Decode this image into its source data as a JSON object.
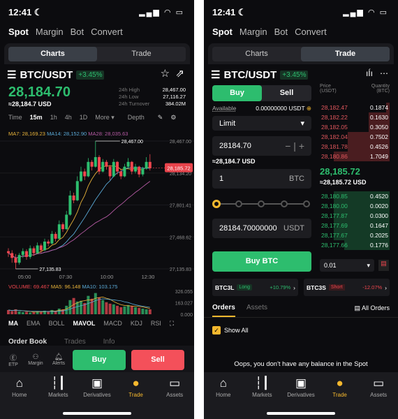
{
  "status": {
    "time": "12:41",
    "moon_icon": "moon-icon",
    "signal": "signal-icon",
    "wifi": "wifi-icon",
    "battery": "battery-icon"
  },
  "top_tabs": [
    "Spot",
    "Margin",
    "Bot",
    "Convert"
  ],
  "segment": {
    "charts": "Charts",
    "trade": "Trade"
  },
  "pair": {
    "name": "BTC/USDT",
    "change": "+3.45%"
  },
  "chart_screen": {
    "price": "28,184.70",
    "usd": "≈28,184.7 USD",
    "stats": [
      {
        "label": "24h High",
        "value": "28,467.00"
      },
      {
        "label": "24h Low",
        "value": "27,116.27"
      },
      {
        "label": "24h Turnover",
        "value": "384.02M"
      }
    ],
    "timeframes": [
      "Time",
      "15m",
      "1h",
      "4h",
      "1D",
      "More ▾",
      "Depth"
    ],
    "ma_legend": {
      "ma7": "MA7: 28,169.23",
      "ma14": "MA14: 28,152.90",
      "ma28": "MA28: 28,035.63"
    },
    "y_ticks": [
      "28,467.00",
      "28,134.20",
      "27,801.41",
      "27,468.62",
      "27,135.83"
    ],
    "x_ticks": [
      "05:00",
      "07:30",
      "10:00",
      "12:30"
    ],
    "high_marker": "28,467.00",
    "low_marker": "27,135.83",
    "last_price": "28,185.72",
    "vol_legend": {
      "vol": "VOLUME: 69.467",
      "ma5": "MA5: 96.148",
      "ma10": "MA10: 103.175"
    },
    "vol_ticks": [
      "326.055",
      "163.027",
      "0.000"
    ],
    "indicators": [
      "MA",
      "EMA",
      "BOLL",
      "MAVOL",
      "MACD",
      "KDJ",
      "RSI"
    ],
    "subtabs": [
      "Order Book",
      "Trades",
      "Info"
    ],
    "actions": [
      {
        "label": "ETP",
        "icon": "etp-icon"
      },
      {
        "label": "Margin",
        "icon": "margin-icon"
      },
      {
        "label": "Alerts",
        "icon": "bell-icon"
      }
    ],
    "buy": "Buy",
    "sell": "Sell"
  },
  "chart_data": {
    "type": "candlestick",
    "ylim": [
      27135.83,
      28467.0
    ],
    "candles": [
      [
        27320,
        27350,
        27260,
        27300
      ],
      [
        27300,
        27330,
        27200,
        27250
      ],
      [
        27250,
        27290,
        27135.83,
        27200
      ],
      [
        27200,
        27300,
        27180,
        27280
      ],
      [
        27280,
        27350,
        27250,
        27320
      ],
      [
        27320,
        27340,
        27230,
        27260
      ],
      [
        27260,
        27380,
        27240,
        27350
      ],
      [
        27350,
        27370,
        27270,
        27300
      ],
      [
        27300,
        27410,
        27290,
        27380
      ],
      [
        27380,
        27400,
        27300,
        27330
      ],
      [
        27330,
        27450,
        27320,
        27420
      ],
      [
        27420,
        27440,
        27370,
        27400
      ],
      [
        27400,
        27530,
        27390,
        27500
      ],
      [
        27500,
        27520,
        27420,
        27450
      ],
      [
        27450,
        27640,
        27440,
        27600
      ],
      [
        27600,
        27620,
        27520,
        27550
      ],
      [
        27550,
        27740,
        27540,
        27700
      ],
      [
        27700,
        27950,
        27690,
        27900
      ],
      [
        27900,
        27930,
        27820,
        27850
      ],
      [
        27850,
        28100,
        27840,
        28050
      ],
      [
        28050,
        28200,
        28040,
        28150
      ],
      [
        28150,
        28180,
        28060,
        28100
      ],
      [
        28100,
        28290,
        28090,
        28250
      ],
      [
        28250,
        28270,
        28160,
        28200
      ],
      [
        28200,
        28467,
        28190,
        28300
      ],
      [
        28300,
        28320,
        28120,
        28150
      ],
      [
        28150,
        28280,
        28140,
        28250
      ],
      [
        28250,
        28270,
        28170,
        28200
      ],
      [
        28200,
        28220,
        28060,
        28100
      ],
      [
        28100,
        28280,
        28090,
        28250
      ],
      [
        28250,
        28260,
        28120,
        28150
      ],
      [
        28150,
        28170,
        28070,
        28100
      ],
      [
        28100,
        28230,
        28090,
        28200
      ],
      [
        28200,
        28290,
        28180,
        28250
      ],
      [
        28250,
        28260,
        28120,
        28150
      ],
      [
        28150,
        28230,
        28130,
        28200
      ],
      [
        28200,
        28210,
        28090,
        28120
      ],
      [
        28120,
        28200,
        28100,
        28180
      ],
      [
        28180,
        28300,
        28170,
        28250
      ],
      [
        28250,
        28330,
        28160,
        28185.72
      ]
    ],
    "volume": [
      60,
      45,
      70,
      40,
      30,
      35,
      25,
      30,
      40,
      35,
      50,
      45,
      60,
      40,
      80,
      70,
      120,
      200,
      230,
      180,
      190,
      160,
      260,
      220,
      300,
      240,
      200,
      170,
      150,
      140,
      120,
      100,
      110,
      130,
      120,
      100,
      90,
      80,
      70,
      69.467
    ]
  },
  "trade_screen": {
    "side_buy": "Buy",
    "side_sell": "Sell",
    "available_label": "Available",
    "available_value": "0.00000000 USDT",
    "order_type": "Limit",
    "price_value": "28184.70",
    "price_usd": "≈28,184.7 USD",
    "amount_value": "1",
    "amount_unit": "BTC",
    "slider_percent": 0,
    "total_value": "28184.70000000",
    "total_unit": "USDT",
    "submit": "Buy BTC",
    "ob_headers": {
      "price": "Price\n(USDT)",
      "qty": "Quantity\n(BTC)"
    },
    "asks": [
      {
        "p": "28,182.47",
        "q": "0.1874",
        "d": 0.95
      },
      {
        "p": "28,182.22",
        "q": "0.1630",
        "d": 0.7
      },
      {
        "p": "28,182.05",
        "q": "0.3050",
        "d": 0.7
      },
      {
        "p": "28,182.04",
        "q": "0.7502",
        "d": 0.4
      },
      {
        "p": "28,181.78",
        "q": "0.4526",
        "d": 0.4
      },
      {
        "p": "28,180.86",
        "q": "1.7049",
        "d": 0.2
      }
    ],
    "mid_price": "28,185.72",
    "mid_usd": "≈28,185.72 USD",
    "bids": [
      {
        "p": "28,180.85",
        "q": "0.4520",
        "d": 0.2
      },
      {
        "p": "28,180.00",
        "q": "0.0020",
        "d": 0.2
      },
      {
        "p": "28,177.87",
        "q": "0.0300",
        "d": 0.2
      },
      {
        "p": "28,177.69",
        "q": "0.1647",
        "d": 0.2
      },
      {
        "p": "28,177.67",
        "q": "0.2025",
        "d": 0.2
      },
      {
        "p": "28,177.66",
        "q": "0.1776",
        "d": 0.35
      }
    ],
    "depth_value": "0.01",
    "etp": [
      {
        "name": "BTC3L",
        "tag": "Long",
        "chg": "+10.79%"
      },
      {
        "name": "BTC3S",
        "tag": "Short",
        "chg": "-12.07%"
      }
    ],
    "orders_tab": "Orders",
    "assets_tab": "Assets",
    "all_orders": "All Orders",
    "show_all": "Show All",
    "empty": "Oops, you don't have any balance in the Spot"
  },
  "nav": [
    {
      "label": "Home",
      "icon": "home-icon"
    },
    {
      "label": "Markets",
      "icon": "candles-icon"
    },
    {
      "label": "Derivatives",
      "icon": "derivatives-icon"
    },
    {
      "label": "Trade",
      "icon": "trade-icon"
    },
    {
      "label": "Assets",
      "icon": "wallet-icon"
    }
  ],
  "colors": {
    "green": "#2dbd6e",
    "red": "#f0464e",
    "accent": "#f5b82e",
    "ma7": "#e8b33a",
    "ma14": "#5aa9d6",
    "ma28": "#b55aa3"
  }
}
